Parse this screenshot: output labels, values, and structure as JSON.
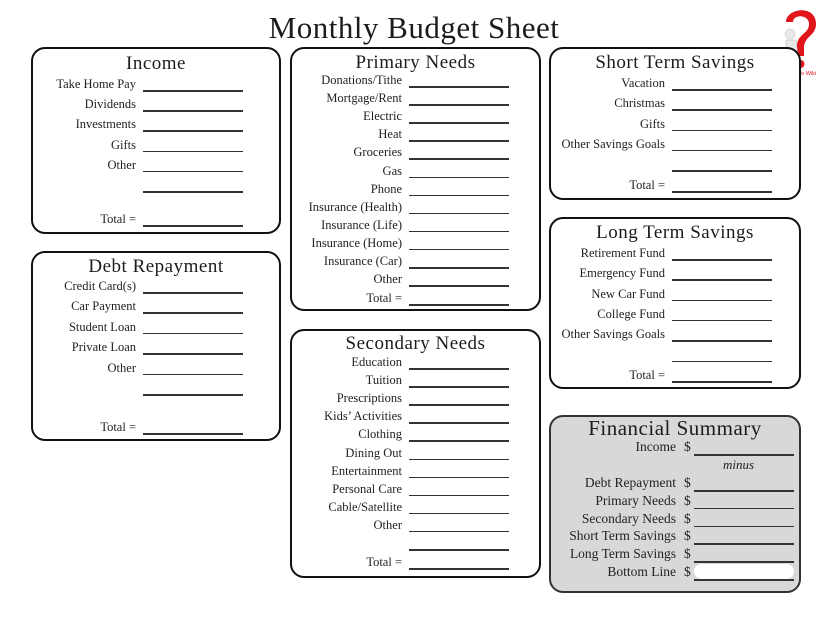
{
  "title": "Monthly Budget Sheet",
  "logo": {
    "icon": "question-mark-figure-icon",
    "text": "How To Wiki",
    "color": "#e0161b"
  },
  "income": {
    "heading": "Income",
    "items": [
      "Take Home Pay",
      "Dividends",
      "Investments",
      "Gifts",
      "Other",
      ""
    ],
    "total_label": "Total ="
  },
  "debt": {
    "heading": "Debt Repayment",
    "items": [
      "Credit Card(s)",
      "Car Payment",
      "Student Loan",
      "Private Loan",
      "Other",
      ""
    ],
    "total_label": "Total ="
  },
  "primary": {
    "heading": "Primary Needs",
    "items": [
      "Donations/Tithe",
      "Mortgage/Rent",
      "Electric",
      "Heat",
      "Groceries",
      "Gas",
      "Phone",
      "Insurance (Health)",
      "Insurance (Life)",
      "Insurance (Home)",
      "Insurance (Car)",
      "Other"
    ],
    "total_label": "Total ="
  },
  "secondary": {
    "heading": "Secondary Needs",
    "items": [
      "Education",
      "Tuition",
      "Prescriptions",
      "Kids’ Activities",
      "Clothing",
      "Dining Out",
      "Entertainment",
      "Personal Care",
      "Cable/Satellite",
      "Other",
      ""
    ],
    "total_label": "Total ="
  },
  "short_term": {
    "heading": "Short Term Savings",
    "items": [
      "Vacation",
      "Christmas",
      "Gifts",
      "Other Savings Goals",
      ""
    ],
    "total_label": "Total ="
  },
  "long_term": {
    "heading": "Long Term Savings",
    "items": [
      "Retirement Fund",
      "Emergency Fund",
      "New Car Fund",
      "College Fund",
      "Other Savings Goals",
      ""
    ],
    "total_label": "Total ="
  },
  "summary": {
    "heading": "Financial Summary",
    "income_label": "Income",
    "minus_label": "minus",
    "items": [
      "Debt Repayment",
      "Primary Needs",
      "Secondary Needs",
      "Short Term Savings",
      "Long Term Savings"
    ],
    "bottom_label": "Bottom Line",
    "currency": "$",
    "bg_color": "#d7d8da"
  }
}
